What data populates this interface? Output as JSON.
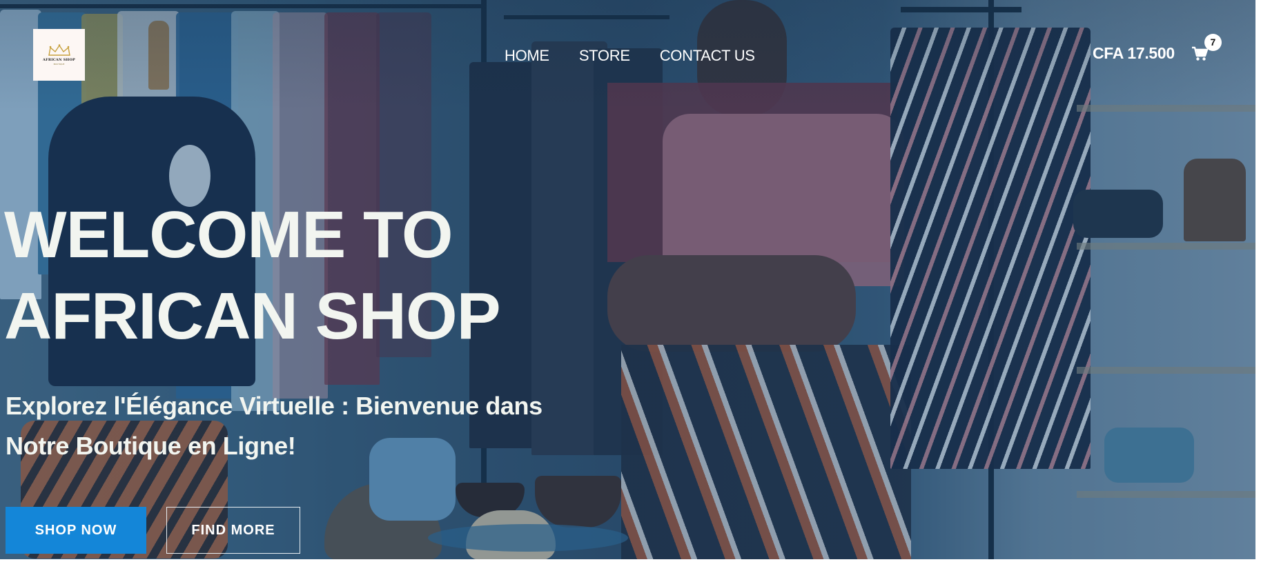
{
  "header": {
    "logo": {
      "brand_text": "AFRICAN SHOP",
      "tagline": "BOUTIQUE"
    },
    "nav": [
      {
        "label": "HOME"
      },
      {
        "label": "STORE"
      },
      {
        "label": "CONTACT US"
      }
    ],
    "cart": {
      "total": "CFA 17.500",
      "count": "7",
      "icon": "shopping-cart-icon"
    }
  },
  "hero": {
    "title_line1": "WELCOME TO",
    "title_line2": "AFRICAN SHOP",
    "subtitle_line1": "Explorez l'Élégance Virtuelle : Bienvenue dans",
    "subtitle_line2": "Notre Boutique en Ligne!",
    "buttons": {
      "primary": "SHOP NOW",
      "secondary": "FIND MORE"
    }
  },
  "colors": {
    "primary_button": "#1486d8",
    "hero_text": "#f2f5f0",
    "overlay": "#204870"
  }
}
